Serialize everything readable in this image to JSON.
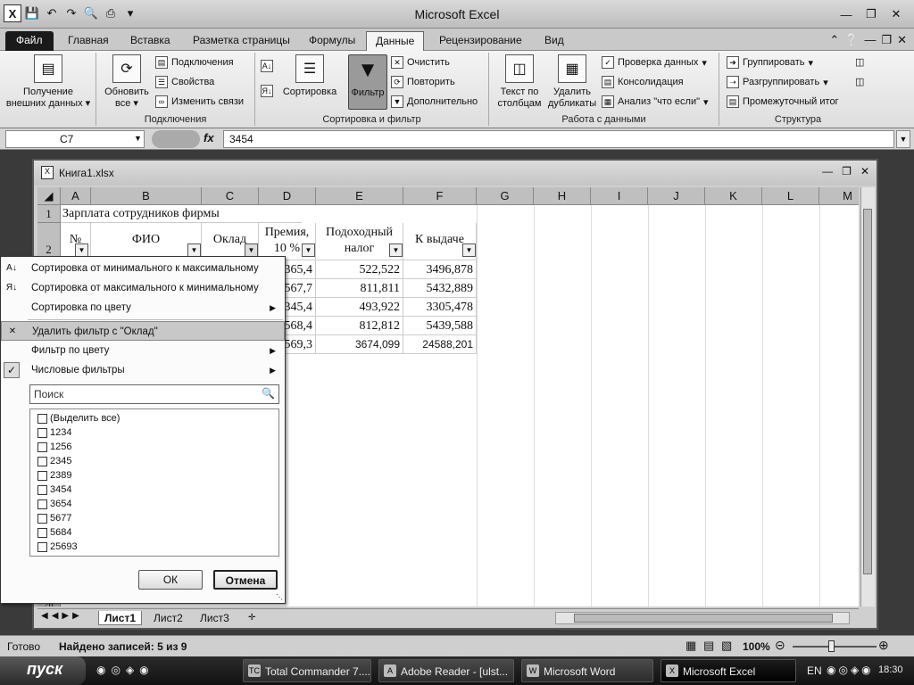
{
  "app": {
    "title": "Microsoft Excel",
    "icon": "excel-icon"
  },
  "ribbon_tabs": [
    "Файл",
    "Главная",
    "Вставка",
    "Разметка страницы",
    "Формулы",
    "Данные",
    "Рецензирование",
    "Вид"
  ],
  "active_tab": "Данные",
  "ribbon": {
    "get_external": "Получение внешних данных",
    "refresh_all": "Обновить все",
    "connections_items": [
      "Подключения",
      "Свойства",
      "Изменить связи"
    ],
    "connections_group": "Подключения",
    "sort_label": "Сортировка",
    "filter_label": "Фильтр",
    "sort_filter_items": [
      "Очистить",
      "Повторить",
      "Дополнительно"
    ],
    "sort_filter_group": "Сортировка и фильтр",
    "text_to_columns": "Текст по столбцам",
    "remove_duplicates": "Удалить дубликаты",
    "data_tools_items": [
      "Проверка данных",
      "Консолидация",
      "Анализ \"что если\""
    ],
    "data_tools_group": "Работа с данными",
    "outline_items": [
      "Группировать",
      "Разгруппировать",
      "Промежуточный итог"
    ],
    "outline_group": "Структура"
  },
  "formula_bar": {
    "name_box": "C7",
    "fx": "fx",
    "value": "3454"
  },
  "workbook": {
    "title": "Книга1.xlsx",
    "columns": [
      "A",
      "B",
      "C",
      "D",
      "E",
      "F",
      "G",
      "H",
      "I",
      "J",
      "K",
      "L",
      "M"
    ],
    "title_cell": "Зарплата сотрудников фирмы",
    "headers": {
      "a": "№",
      "b": "ФИО",
      "c": "Оклад",
      "d": "Премия, 10 %",
      "e": "Подоходный налог",
      "f": "К выдаче"
    },
    "rows": [
      {
        "d": "365,4",
        "e": "522,522",
        "f": "3496,878"
      },
      {
        "d": "567,7",
        "e": "811,811",
        "f": "5432,889"
      },
      {
        "d": "345,4",
        "e": "493,922",
        "f": "3305,478"
      },
      {
        "d": "568,4",
        "e": "812,812",
        "f": "5439,588"
      },
      {
        "d": "2569,3",
        "e": "3674,099",
        "f": "24588,201"
      }
    ],
    "row_labels": [
      "1",
      "2",
      "26"
    ],
    "sheets": [
      "Лист1",
      "Лист2",
      "Лист3"
    ]
  },
  "filter_menu": {
    "sort_asc": "Сортировка от минимального к максимальному",
    "sort_desc": "Сортировка от максимального к минимальному",
    "sort_color": "Сортировка по цвету",
    "clear_filter": "Удалить фильтр с \"Оклад\"",
    "filter_color": "Фильтр по цвету",
    "number_filters": "Числовые фильтры",
    "search_placeholder": "Поиск",
    "select_all": "(Выделить все)",
    "values": [
      "1234",
      "1256",
      "2345",
      "2389",
      "3454",
      "3654",
      "5677",
      "5684",
      "25693"
    ],
    "ok": "ОК",
    "cancel": "Отмена"
  },
  "status": {
    "ready": "Готово",
    "found": "Найдено записей: 5 из 9",
    "zoom": "100%"
  },
  "taskbar": {
    "start": "пуск",
    "tasks": [
      "Total Commander 7....",
      "Adobe Reader - [ulst...",
      "Microsoft Word",
      "Microsoft Excel"
    ],
    "lang": "EN",
    "time": "18:30"
  }
}
